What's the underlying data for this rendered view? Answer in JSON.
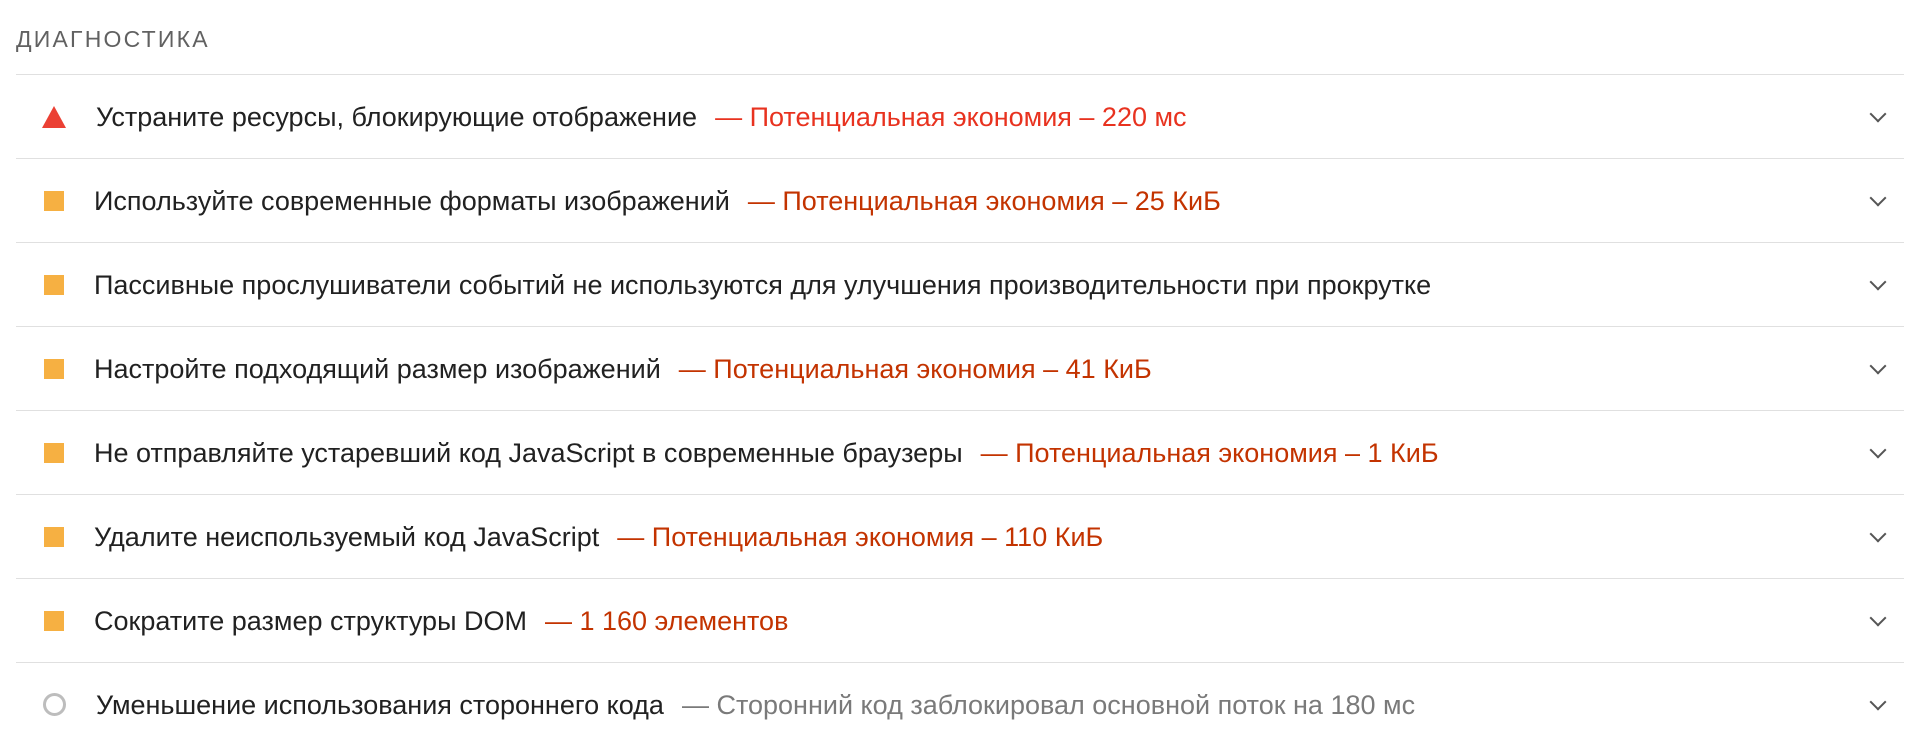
{
  "section": {
    "title": "ДИАГНОСТИКА"
  },
  "colors": {
    "fail": "#eb4034",
    "average": "#f6b042",
    "info": "#bdbdbd",
    "display_fail": "#e8321f",
    "display_average": "#c33300",
    "display_info": "#7a7a7a"
  },
  "audits": [
    {
      "status": "fail",
      "icon": "red-triangle-icon",
      "title": "Устраните ресурсы, блокирующие отображение",
      "display": "— Потенциальная экономия – 220 мс"
    },
    {
      "status": "average",
      "icon": "orange-square-icon",
      "title": "Используйте современные форматы изображений",
      "display": "— Потенциальная экономия – 25 КиБ"
    },
    {
      "status": "average",
      "icon": "orange-square-icon",
      "title": "Пассивные прослушиватели событий не используются для улучшения производительности при прокрутке",
      "display": ""
    },
    {
      "status": "average",
      "icon": "orange-square-icon",
      "title": "Настройте подходящий размер изображений",
      "display": "— Потенциальная экономия – 41 КиБ"
    },
    {
      "status": "average",
      "icon": "orange-square-icon",
      "title": "Не отправляйте устаревший код JavaScript в современные браузеры",
      "display": "— Потенциальная экономия – 1 КиБ"
    },
    {
      "status": "average",
      "icon": "orange-square-icon",
      "title": "Удалите неиспользуемый код JavaScript",
      "display": "— Потенциальная экономия – 110 КиБ"
    },
    {
      "status": "average",
      "icon": "orange-square-icon",
      "title": "Сократите размер структуры DOM",
      "display": "— 1 160 элементов"
    },
    {
      "status": "info",
      "icon": "grey-circle-icon",
      "title": "Уменьшение использования стороннего кода",
      "display": "— Сторонний код заблокировал основной поток на 180 мс"
    }
  ]
}
